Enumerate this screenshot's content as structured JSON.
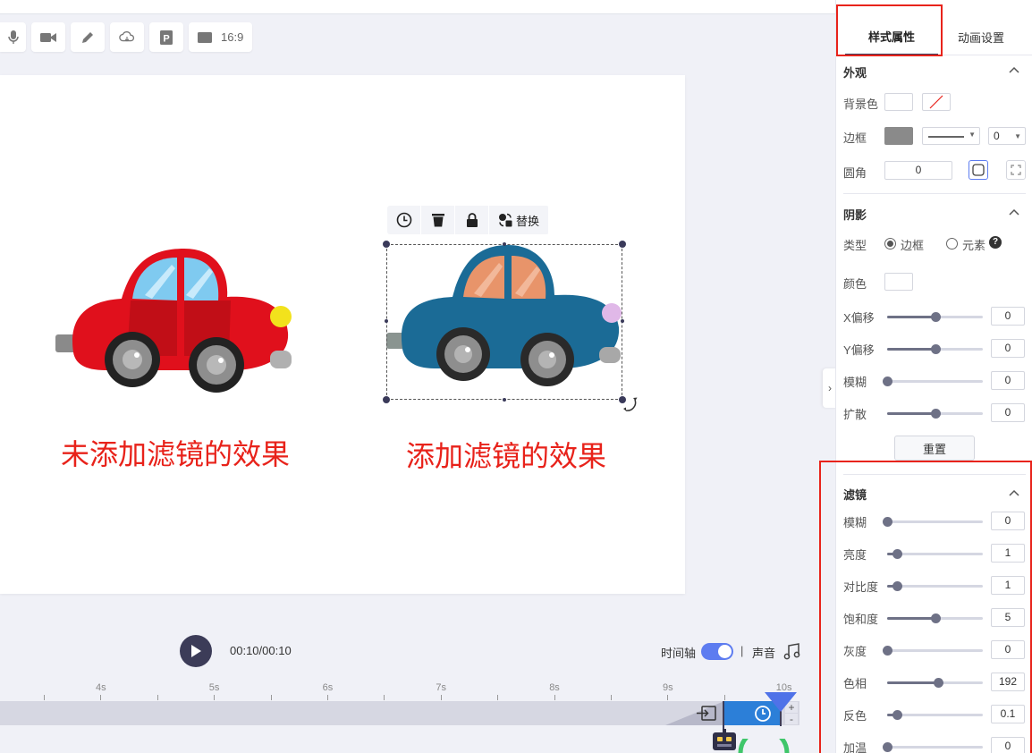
{
  "toolbar": {
    "items": [
      {
        "icon": "microphone-icon"
      },
      {
        "icon": "camera-icon"
      },
      {
        "icon": "pen-icon"
      },
      {
        "icon": "cloud-icon"
      },
      {
        "icon": "p-icon"
      },
      {
        "icon": "ratio-icon",
        "label": "16:9"
      }
    ]
  },
  "canvas": {
    "left_caption": "未添加滤镜的效果",
    "right_caption": "添加滤镜的效果",
    "left_car_color": "#e0101c",
    "right_car_color": "#1b6b96"
  },
  "float_toolbar": {
    "replace_label": "替换"
  },
  "player": {
    "timecode": "00:10/00:10",
    "timeline_label": "时间轴",
    "timeline_on": true,
    "separator": "|",
    "sound_label": "声音"
  },
  "ruler": {
    "labels": [
      "4s",
      "5s",
      "6s",
      "7s",
      "8s",
      "9s",
      "10s"
    ]
  },
  "panel": {
    "tabs": {
      "style": "样式属性",
      "animation": "动画设置"
    },
    "appearance": {
      "title": "外观",
      "bg_label": "背景色",
      "border_label": "边框",
      "border_width": "0",
      "radius_label": "圆角",
      "radius_value": "0",
      "border_color": "#8a8a8a"
    },
    "shadow": {
      "title": "阴影",
      "type_label": "类型",
      "type_border": "边框",
      "type_element": "元素",
      "color_label": "颜色",
      "rows": [
        {
          "label": "X偏移",
          "value": "0",
          "level": 0.5
        },
        {
          "label": "Y偏移",
          "value": "0",
          "level": 0.5
        },
        {
          "label": "模糊",
          "value": "0",
          "level": 0
        },
        {
          "label": "扩散",
          "value": "0",
          "level": 0.5
        }
      ],
      "reset_label": "重置"
    },
    "filter": {
      "title": "滤镜",
      "rows": [
        {
          "label": "模糊",
          "value": "0",
          "level": 0
        },
        {
          "label": "亮度",
          "value": "1",
          "level": 0.1
        },
        {
          "label": "对比度",
          "value": "1",
          "level": 0.1
        },
        {
          "label": "饱和度",
          "value": "5",
          "level": 0.5
        },
        {
          "label": "灰度",
          "value": "0",
          "level": 0
        },
        {
          "label": "色相",
          "value": "192",
          "level": 0.53
        },
        {
          "label": "反色",
          "value": "0.1",
          "level": 0.1
        },
        {
          "label": "加温",
          "value": "0",
          "level": 0
        }
      ]
    }
  }
}
